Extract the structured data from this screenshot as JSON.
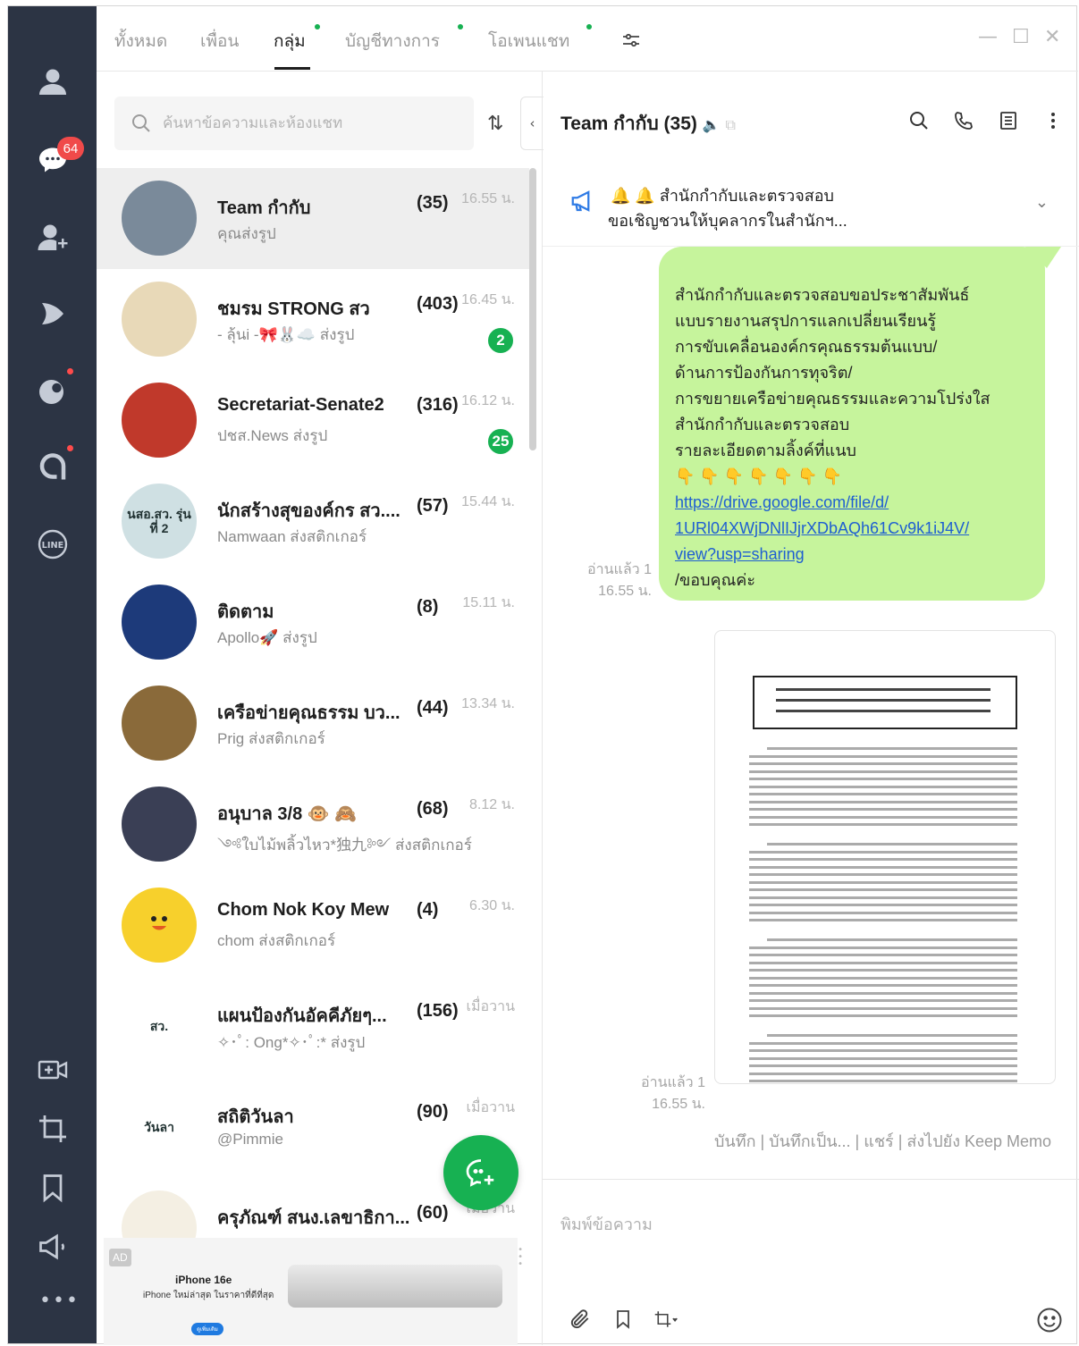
{
  "rail": {
    "chat_badge": "64"
  },
  "tabs": [
    {
      "label": "ทั้งหมด",
      "active": false,
      "dot": false
    },
    {
      "label": "เพื่อน",
      "active": false,
      "dot": false
    },
    {
      "label": "กลุ่ม",
      "active": true,
      "dot": true
    },
    {
      "label": "บัญชีทางการ",
      "active": false,
      "dot": true
    },
    {
      "label": "โอเพนแชท",
      "active": false,
      "dot": true
    }
  ],
  "search": {
    "placeholder": "ค้นหาข้อความและห้องแชท"
  },
  "chats": [
    {
      "name": "Team กำกับ",
      "count": "(35)",
      "preview": "คุณส่งรูป",
      "time": "16.55 น.",
      "unread": "",
      "avatar_color": "#7a8a9a"
    },
    {
      "name": "ชมรม STRONG สว",
      "count": "(403)",
      "preview": "- ลุ้นi -🎀🐰☁️ ส่งรูป",
      "time": "16.45 น.",
      "unread": "2",
      "avatar_color": "#e8d9b8"
    },
    {
      "name": "Secretariat-Senate2",
      "count": "(316)",
      "preview": "ปชส.News ส่งรูป",
      "time": "16.12 น.",
      "unread": "25",
      "avatar_color": "#c0392b"
    },
    {
      "name": "นักสร้างสุของค์กร สว....",
      "count": "(57)",
      "preview": "Namwaan ส่งสติกเกอร์",
      "time": "15.44 น.",
      "unread": "",
      "avatar_color": "#cfe0e3",
      "avatar_text": "นสอ.สว. รุ่นที่ 2"
    },
    {
      "name": "ติดตาม",
      "count": "(8)",
      "preview": "Apollo🚀 ส่งรูป",
      "time": "15.11 น.",
      "unread": "",
      "avatar_color": "#1d3a7a"
    },
    {
      "name": "เครือข่ายคุณธรรม บว...",
      "count": "(44)",
      "preview": "Prig ส่งสติกเกอร์",
      "time": "13.34 น.",
      "unread": "",
      "avatar_color": "#8a6a3a"
    },
    {
      "name": "อนุบาล 3/8 🐵 🙈",
      "count": "(68)",
      "preview": "༺ใบไม้พลิ้วไหว*独九༻ ส่งสติกเกอร์",
      "time": "8.12 น.",
      "unread": "",
      "avatar_color": "#3a3f55"
    },
    {
      "name": "Chom Nok Koy Mew",
      "count": "(4)",
      "preview": "chom ส่งสติกเกอร์",
      "time": "6.30 น.",
      "unread": "",
      "avatar_color": "#f7d02c"
    },
    {
      "name": "แผนป้องกันอัคคีภัยๆ...",
      "count": "(156)",
      "preview": "✧･ﾟ: Ong*✧･ﾟ:* ส่งรูป",
      "time": "เมื่อวาน",
      "unread": "",
      "avatar_color": "#ffffff",
      "avatar_text": "สว."
    },
    {
      "name": "สถิติวันลา",
      "count": "(90)",
      "preview": "@Pimmie",
      "time": "เมื่อวาน",
      "unread": "",
      "avatar_color": "#ffffff",
      "avatar_text": "วันลา"
    },
    {
      "name": "ครุภัณฑ์ สนง.เลขาธิกา...",
      "count": "(60)",
      "preview": "",
      "time": "เมื่อวาน",
      "unread": "",
      "avatar_color": "#f4efe3"
    }
  ],
  "ad": {
    "tag": "AD",
    "title": "iPhone 16e",
    "subtitle": "iPhone ใหม่ล่าสุด ในราคาที่ดีที่สุด",
    "button": "ดูเพิ่มเติม"
  },
  "room": {
    "title": "Team กำกับ",
    "count": "(35)",
    "announcement_line1": "🔔 🔔 สำนักกำกับและตรวจสอบ",
    "announcement_line2": "ขอเชิญชวนให้บุคลากรในสำนักฯ...",
    "message_lines": [
      "สำนักกำกับและตรวจสอบขอประชาสัมพันธ์",
      "แบบรายงานสรุปการแลกเปลี่ยนเรียนรู้",
      "การขับเคลื่อนองค์กรคุณธรรมต้นแบบ/",
      "ด้านการป้องกันการทุจริต/",
      "การขยายเครือข่ายคุณธรรมและความโปร่งใส",
      "สำนักกำกับและตรวจสอบ",
      "รายละเอียดตามลิ้งค์ที่แนบ",
      "👇 👇 👇 👇 👇 👇 👇"
    ],
    "message_link_lines": [
      "https://drive.google.com/file/d/",
      "1URl04XWjDNlIJjrXDbAQh61Cv9k1iJ4V/",
      "view?usp=sharing"
    ],
    "message_end": "/ขอบคุณค่ะ",
    "read_label": "อ่านแล้ว 1",
    "message_time": "16.55 น.",
    "image_read_label": "อ่านแล้ว 1",
    "image_time": "16.55 น.",
    "image_actions": "บันทึก | บันทึกเป็น... | แชร์ | ส่งไปยัง Keep Memo",
    "composer_placeholder": "พิมพ์ข้อความ"
  }
}
